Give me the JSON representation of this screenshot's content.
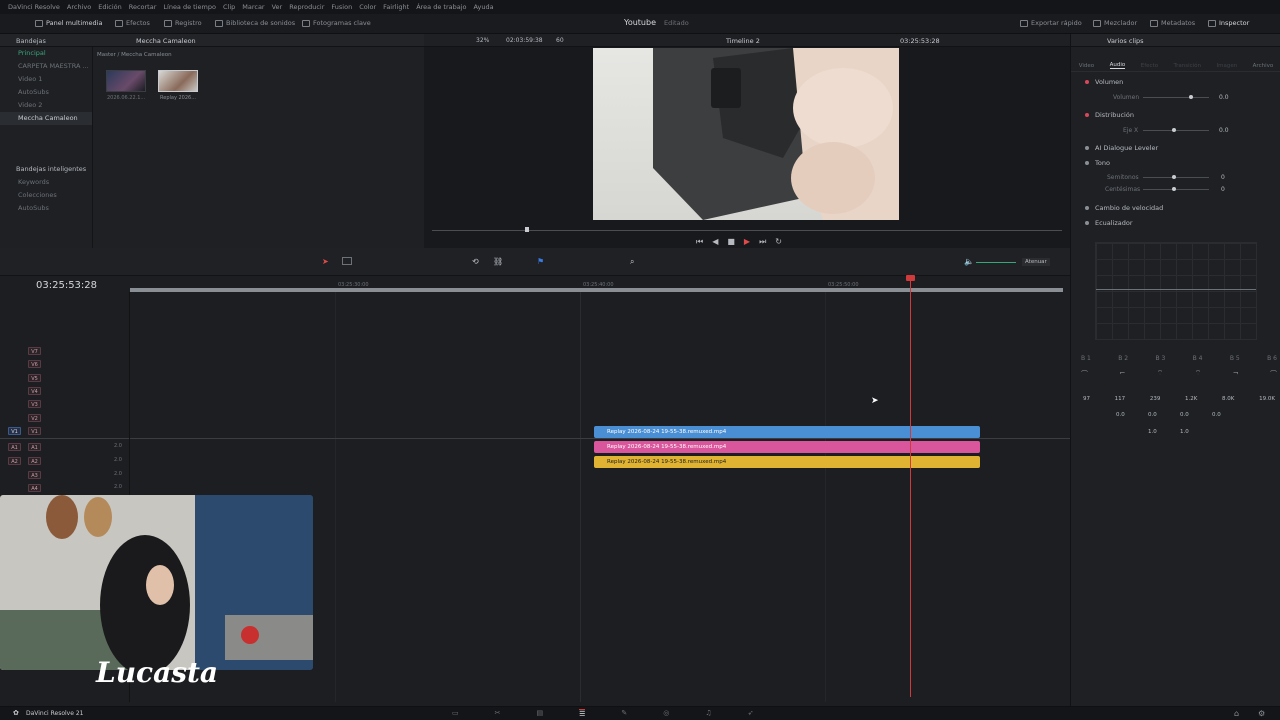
{
  "menu": [
    "DaVinci Resolve",
    "Archivo",
    "Edición",
    "Recortar",
    "Línea de tiempo",
    "Clip",
    "Marcar",
    "Ver",
    "Reproducir",
    "Fusion",
    "Color",
    "Fairlight",
    "Área de trabajo",
    "Ayuda"
  ],
  "topbar": {
    "panel_multimedia": "Panel multimedia",
    "efectos": "Efectos",
    "registro": "Registro",
    "biblioteca": "Biblioteca de sonidos",
    "fotogramas": "Fotogramas clave",
    "project": "Youtube",
    "project_state": "Editado",
    "exportar": "Exportar rápido",
    "mezclador": "Mezclador",
    "metadatos": "Metadatos",
    "inspector": "Inspector"
  },
  "bins": {
    "header": "Bandejas",
    "path_title": "Meccha Camaleon",
    "breadcrumb": "Master / Meccha Camaleon",
    "items": [
      "Principal",
      "CARPETA MAESTRA ...",
      "Video 1",
      "AutoSubs",
      "Video 2",
      "Meccha Camaleon"
    ],
    "smart_header": "Bandejas inteligentes",
    "smart_items": [
      "Keywords",
      "Colecciones",
      "AutoSubs"
    ],
    "thumbs": [
      "2026.06.22.1...",
      "Replay 2026..."
    ]
  },
  "viewer": {
    "zoom": "32%",
    "src_tc": "02:03:59:38",
    "fps": "60",
    "timeline_name": "Timeline 2",
    "rec_tc": "03:25:53:28"
  },
  "inspector": {
    "title": "Varios clips",
    "tabs": [
      "Video",
      "Audio",
      "Efecto",
      "Transición",
      "Imagen",
      "Archivo"
    ],
    "sections": {
      "volumen": "Volumen",
      "volumen_lbl": "Volumen",
      "volumen_val": "0.0",
      "distribucion": "Distribución",
      "eje_lbl": "Eje X",
      "eje_val": "0.0",
      "dialogue": "AI Dialogue Leveler",
      "tono": "Tono",
      "semitonos": "Semitonos",
      "semitonos_val": "0",
      "centesimas": "Centésimas",
      "centesimas_val": "0",
      "velocidad": "Cambio de velocidad",
      "ecualizador": "Ecualizador"
    },
    "bands": [
      "B 1",
      "B 2",
      "B 3",
      "B 4",
      "B 5",
      "B 6"
    ],
    "freqs": [
      "97",
      "117",
      "239",
      "1.2K",
      "8.0K",
      "19.0K"
    ],
    "gains": [
      "0.0",
      "0.0",
      "0.0",
      "0.0"
    ],
    "qs": [
      "1.0",
      "1.0"
    ]
  },
  "timeline": {
    "timecode": "03:25:53:28",
    "ruler": [
      "03:25:30:00",
      "03:25:40:00",
      "03:25:50:00"
    ],
    "video_tracks": [
      "V7",
      "V6",
      "V5",
      "V4",
      "V3",
      "V2",
      "V1"
    ],
    "audio_tracks": [
      "A1",
      "A2",
      "A3",
      "A4"
    ],
    "audio_level": "2.0",
    "clip_name": "Replay 2026-08-24 19-55-38.remuxed.mp4",
    "atenuar": "Atenuar"
  },
  "footer": {
    "app": "DaVinci Resolve 21"
  },
  "overlay": {
    "streamer": "Lucasta"
  },
  "colors": {
    "video_clip": "#4a8fd4",
    "audio_clip_1": "#d9569c",
    "audio_clip_2": "#e0b432",
    "playhead": "#d03a3a"
  }
}
